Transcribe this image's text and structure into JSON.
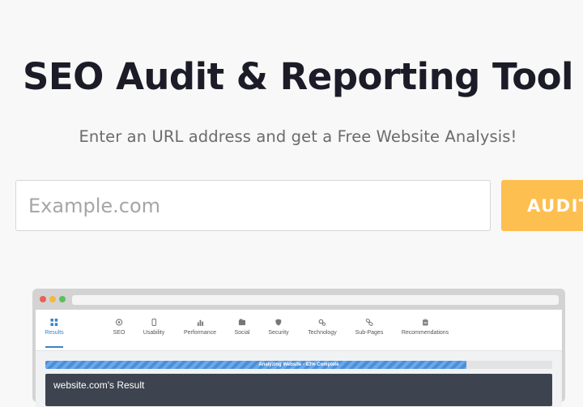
{
  "hero": {
    "title": "SEO Audit & Reporting Tool",
    "subtitle": "Enter an URL address and get a Free Website Analysis!"
  },
  "form": {
    "url_placeholder": "Example.com",
    "url_value": "",
    "submit_label": "AUDIT"
  },
  "preview": {
    "tabs": [
      {
        "label": "Results",
        "icon": "grid-icon",
        "active": true
      },
      {
        "label": "SEO",
        "icon": "target-icon",
        "active": false
      },
      {
        "label": "Usability",
        "icon": "mobile-icon",
        "active": false
      },
      {
        "label": "Performance",
        "icon": "bar-chart-icon",
        "active": false
      },
      {
        "label": "Social",
        "icon": "social-icon",
        "active": false
      },
      {
        "label": "Security",
        "icon": "shield-icon",
        "active": false
      },
      {
        "label": "Technology",
        "icon": "gears-icon",
        "active": false
      },
      {
        "label": "Sub-Pages",
        "icon": "link-icon",
        "active": false
      },
      {
        "label": "Recommendations",
        "icon": "clipboard-icon",
        "active": false
      }
    ],
    "progress": {
      "label": "Analyzing Website - 83% Complete",
      "fraction": 0.83
    },
    "result_title": "website.com's Result"
  },
  "colors": {
    "accent": "#fdbf4f",
    "tab_active": "#3a83c6",
    "progress": "#4a8fd8",
    "result_bar": "#3d4450"
  }
}
